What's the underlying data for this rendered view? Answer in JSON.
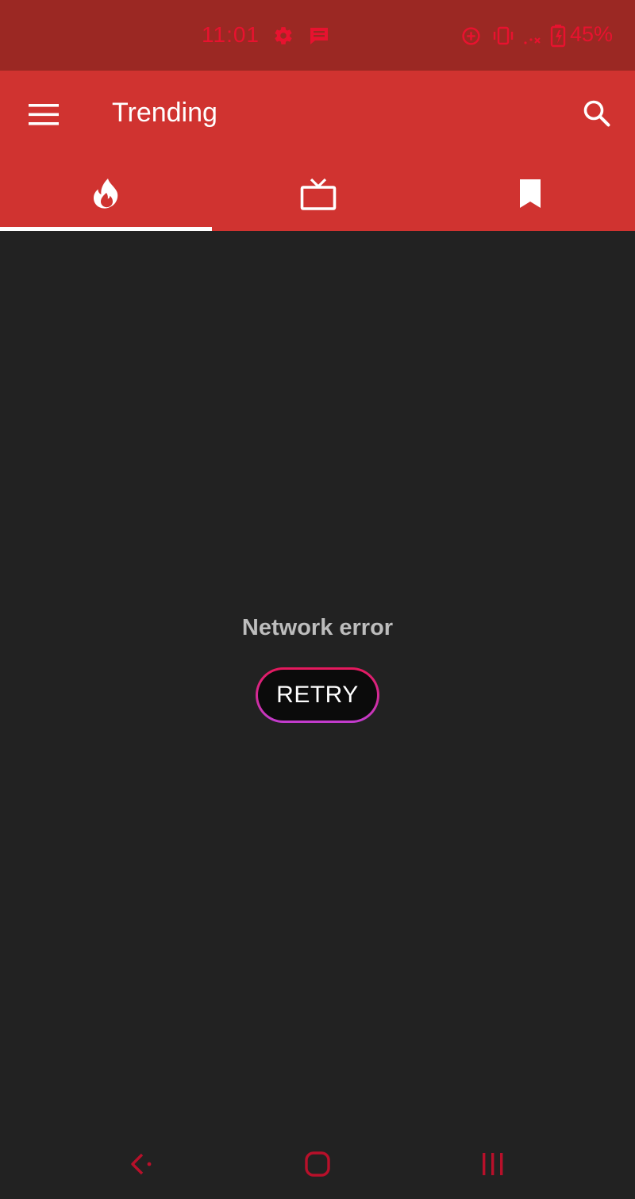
{
  "status_bar": {
    "time": "11:01",
    "battery": "45%",
    "icons": [
      "settings-gear-icon",
      "message-icon",
      "data-saver-icon",
      "vibrate-icon",
      "no-signal-icon",
      "battery-charging-icon"
    ],
    "accent_color": "#e8122f"
  },
  "toolbar": {
    "title": "Trending",
    "menu_icon": "hamburger-menu-icon",
    "search_icon": "search-icon",
    "background_color": "#d03330"
  },
  "tabs": [
    {
      "icon": "fire-icon",
      "selected": true
    },
    {
      "icon": "tv-icon",
      "selected": false
    },
    {
      "icon": "bookmark-icon",
      "selected": false
    }
  ],
  "content": {
    "error_message": "Network error",
    "retry_label": "RETRY"
  },
  "nav_bar": {
    "icons": [
      "back-icon",
      "home-icon",
      "recents-icon"
    ],
    "color": "#b8102a"
  }
}
